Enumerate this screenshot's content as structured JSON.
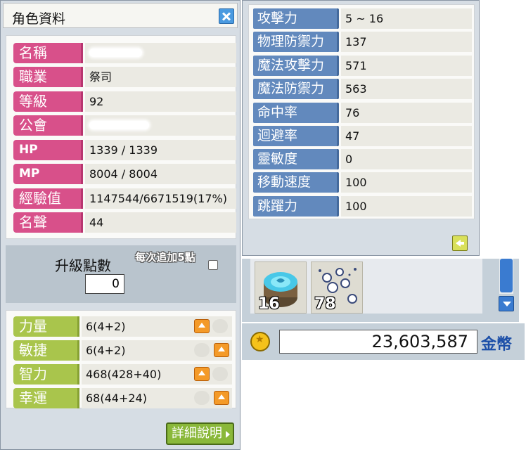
{
  "character_window": {
    "title": "角色資料",
    "info_rows": [
      {
        "label": "名稱",
        "value": ""
      },
      {
        "label": "職業",
        "value": "祭司"
      },
      {
        "label": "等級",
        "value": "92"
      },
      {
        "label": "公會",
        "value": ""
      },
      {
        "label": "HP",
        "value": "1339 / 1339"
      },
      {
        "label": "MP",
        "value": "8004 / 8004"
      },
      {
        "label": "經驗值",
        "value": "1147544/6671519(17%)"
      },
      {
        "label": "名聲",
        "value": "44"
      }
    ],
    "level_up": {
      "label": "升級點數",
      "points": "0",
      "per_add_label": "每次追加5點"
    },
    "stats": [
      {
        "label": "力量",
        "value": "6(4+2)"
      },
      {
        "label": "敏捷",
        "value": "6(4+2)"
      },
      {
        "label": "智力",
        "value": "468(428+40)"
      },
      {
        "label": "幸運",
        "value": "68(44+24)"
      }
    ],
    "detail_button": "詳細說明"
  },
  "detail_stats": [
    {
      "label": "攻擊力",
      "value": "5 ~ 16"
    },
    {
      "label": "物理防禦力",
      "value": "137"
    },
    {
      "label": "魔法攻擊力",
      "value": "571"
    },
    {
      "label": "魔法防禦力",
      "value": "563"
    },
    {
      "label": "命中率",
      "value": "76"
    },
    {
      "label": "迴避率",
      "value": "47"
    },
    {
      "label": "靈敏度",
      "value": "0"
    },
    {
      "label": "移動速度",
      "value": "100"
    },
    {
      "label": "跳躍力",
      "value": "100"
    }
  ],
  "inventory": {
    "slots": [
      {
        "icon": "summoning-rock-icon",
        "count": "16"
      },
      {
        "icon": "snowflake-item-icon",
        "count": "78"
      }
    ]
  },
  "meso": {
    "amount": "23,603,587",
    "unit": "金幣"
  },
  "colors": {
    "info_label": "#d8508a",
    "stat_label": "#a9c54c",
    "detail_label": "#6289bd",
    "up_button": "#f49a28"
  }
}
